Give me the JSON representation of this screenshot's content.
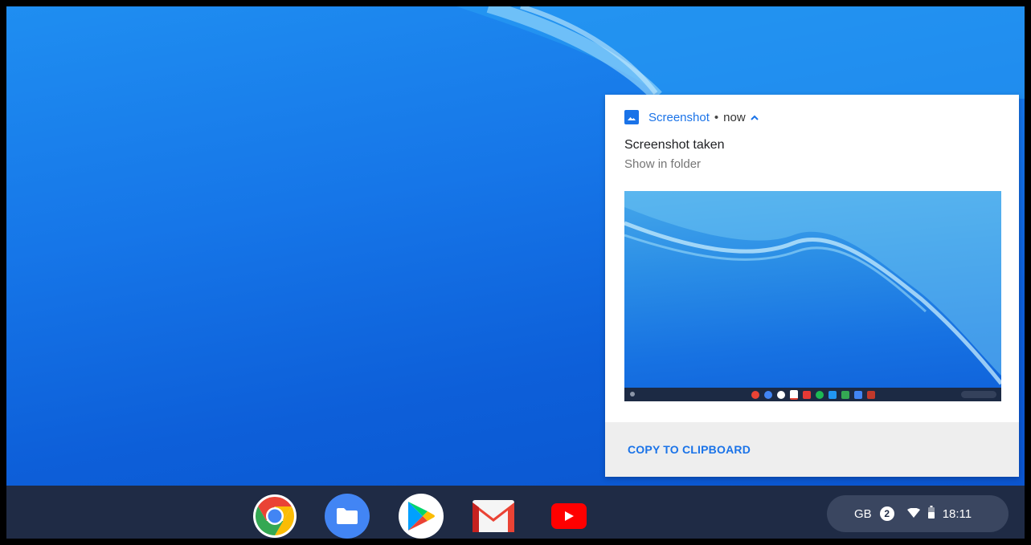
{
  "notification": {
    "app_name": "Screenshot",
    "separator": "•",
    "time": "now",
    "title": "Screenshot taken",
    "message": "Show in folder",
    "action_label": "COPY TO CLIPBOARD"
  },
  "shelf": {
    "apps": [
      "chrome-icon",
      "files-icon",
      "play-store-icon",
      "gmail-icon",
      "youtube-icon"
    ]
  },
  "tray": {
    "keyboard_layout": "GB",
    "notification_count": "2",
    "time": "18:11"
  },
  "colors": {
    "accent": "#1a73e8",
    "shelf": "#1f2b45",
    "tray": "#3a4660"
  }
}
